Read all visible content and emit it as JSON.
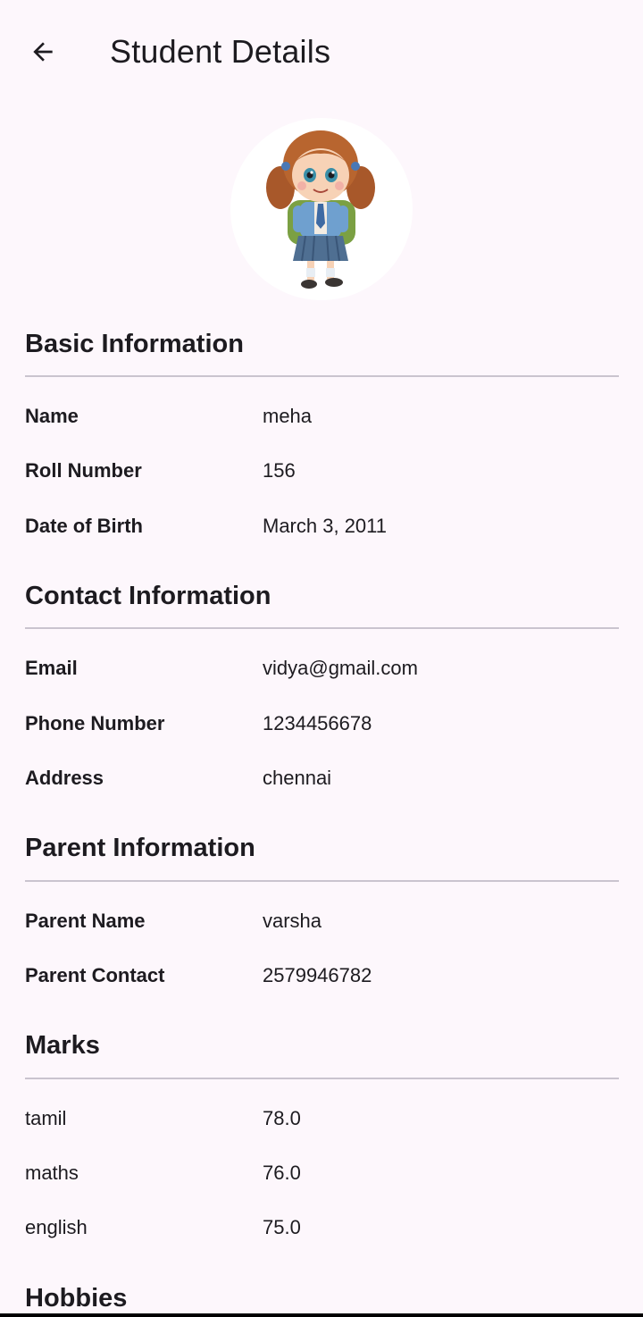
{
  "header": {
    "title": "Student Details",
    "back_icon": "arrow-left-icon"
  },
  "avatar": {
    "icon": "student-avatar"
  },
  "sections": {
    "basic": {
      "title": "Basic Information",
      "rows": [
        {
          "label": "Name",
          "value": "meha"
        },
        {
          "label": "Roll Number",
          "value": "156"
        },
        {
          "label": "Date of Birth",
          "value": "March 3, 2011"
        }
      ]
    },
    "contact": {
      "title": "Contact Information",
      "rows": [
        {
          "label": "Email",
          "value": "vidya@gmail.com"
        },
        {
          "label": "Phone Number",
          "value": "1234456678"
        },
        {
          "label": "Address",
          "value": "chennai"
        }
      ]
    },
    "parent": {
      "title": "Parent Information",
      "rows": [
        {
          "label": "Parent Name",
          "value": "varsha"
        },
        {
          "label": "Parent Contact",
          "value": "2579946782"
        }
      ]
    },
    "marks": {
      "title": "Marks",
      "rows": [
        {
          "label": "tamil",
          "value": "78.0"
        },
        {
          "label": "maths",
          "value": "76.0"
        },
        {
          "label": "english",
          "value": "75.0"
        }
      ]
    },
    "hobbies": {
      "title": "Hobbies"
    }
  },
  "colors": {
    "background": "#fdf7fc",
    "text": "#1d1b20",
    "divider": "#cac4cf"
  }
}
